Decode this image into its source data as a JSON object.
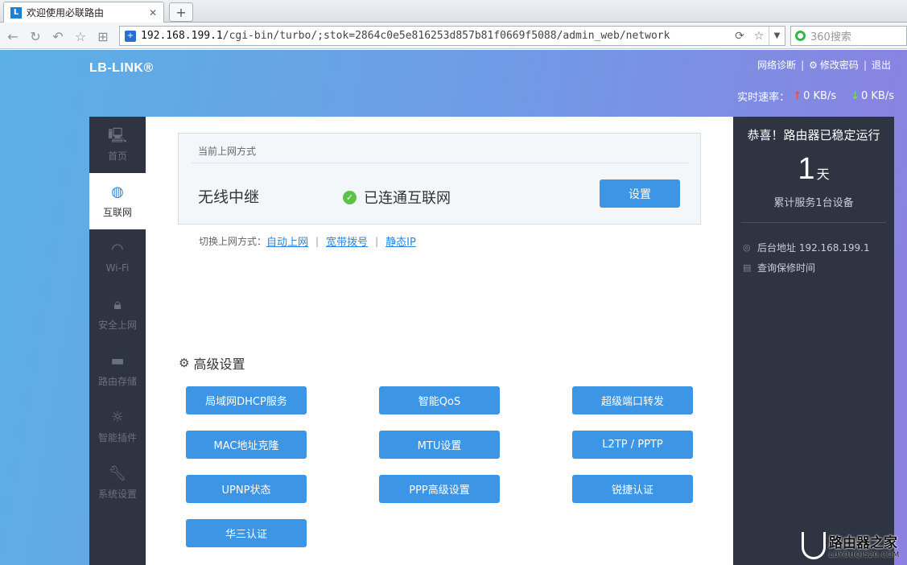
{
  "browser": {
    "tab_title": "欢迎使用必联路由",
    "tab_close": "✕",
    "new_tab": "+",
    "url_host": "192.168.199.1",
    "url_path": "/cgi-bin/turbo/;stok=2864c0e5e816253d857b81f0669f5088/admin_web/network",
    "search_placeholder": "360搜索"
  },
  "header": {
    "logo": "LB-LINK®",
    "links": [
      "网络诊断",
      "修改密码",
      "退出"
    ],
    "speed_label": "实时速率：",
    "upload": "0 KB/s",
    "download": "0 KB/s"
  },
  "sidebar": {
    "items": [
      {
        "label": "首页",
        "icon": "monitor-icon"
      },
      {
        "label": "互联网",
        "icon": "globe-icon"
      },
      {
        "label": "Wi-Fi",
        "icon": "wifi-icon"
      },
      {
        "label": "安全上网",
        "icon": "lock-icon"
      },
      {
        "label": "路由存储",
        "icon": "folder-icon"
      },
      {
        "label": "智能插件",
        "icon": "bulb-icon"
      },
      {
        "label": "系统设置",
        "icon": "wrench-icon"
      }
    ],
    "active_index": 1
  },
  "network": {
    "section_title": "当前上网方式",
    "mode": "无线中继",
    "status": "已连通互联网",
    "settings_button": "设置",
    "switch_label": "切换上网方式：",
    "switch_options": [
      "自动上网",
      "宽带拨号",
      "静态IP"
    ]
  },
  "advanced": {
    "title": "高级设置",
    "buttons": [
      "局域网DHCP服务",
      "智能QoS",
      "超级端口转发",
      "MAC地址克隆",
      "MTU设置",
      "L2TP / PPTP",
      "UPNP状态",
      "PPP高级设置",
      "锐捷认证",
      "华三认证"
    ]
  },
  "status_panel": {
    "congrats": "恭喜！路由器已稳定运行",
    "days": "1",
    "days_unit": "天",
    "served": "累计服务1台设备",
    "admin_address": "后台地址 192.168.199.1",
    "warranty": "查询保修时间"
  },
  "watermark": {
    "line1": "路由器之家",
    "line2": "LUYOUQI520.COM"
  }
}
